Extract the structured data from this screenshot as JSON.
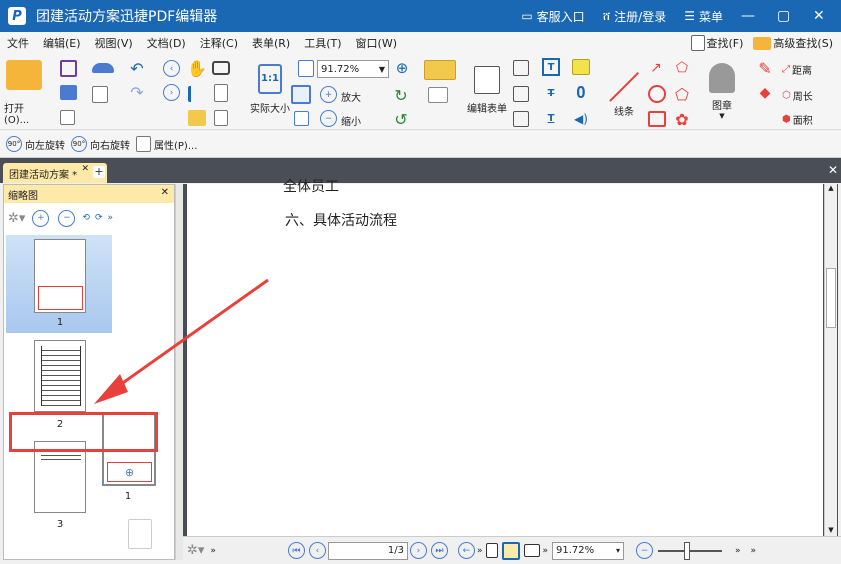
{
  "window": {
    "title": "团建活动方案迅捷PDF编辑器",
    "service": "客服入口",
    "login": "注册/登录",
    "menu": "菜单",
    "logo_letter": "P"
  },
  "menubar": {
    "items": [
      "文件",
      "编辑(E)",
      "视图(V)",
      "文档(D)",
      "注释(C)",
      "表单(R)",
      "工具(T)",
      "窗口(W)"
    ],
    "find": "查找(F)",
    "advanced_find": "高级查找(S)"
  },
  "ribbon": {
    "open": "打开(O)...",
    "zoom_value": "91.72%",
    "actual_size": "实际大小",
    "one_to_one": "1:1",
    "zoom_in": "放大",
    "zoom_out": "缩小",
    "edit_form": "编辑表单",
    "line": "线条",
    "stamp": "图章",
    "distance": "距离",
    "perimeter": "周长",
    "area": "面积"
  },
  "toolbar2": {
    "rotate_left": "向左旋转",
    "rotate_right": "向右旋转",
    "properties": "属性(P)...",
    "deg_left": "90°",
    "deg_right": "90°"
  },
  "tab": {
    "name": "团建活动方案 *"
  },
  "sidebar": {
    "title": "缩略图",
    "thumbnails": [
      "1",
      "2",
      "3"
    ],
    "dragged_label": "1"
  },
  "document": {
    "visible_heading": "六、具体活动流程",
    "clipped_line": "全体员工"
  },
  "status": {
    "page_current": "1",
    "page_total": "3",
    "zoom_value": "91.72%"
  },
  "colors": {
    "titlebar": "#1a67b3",
    "annotation": "#e8413b",
    "highlight": "#fde9a8"
  }
}
